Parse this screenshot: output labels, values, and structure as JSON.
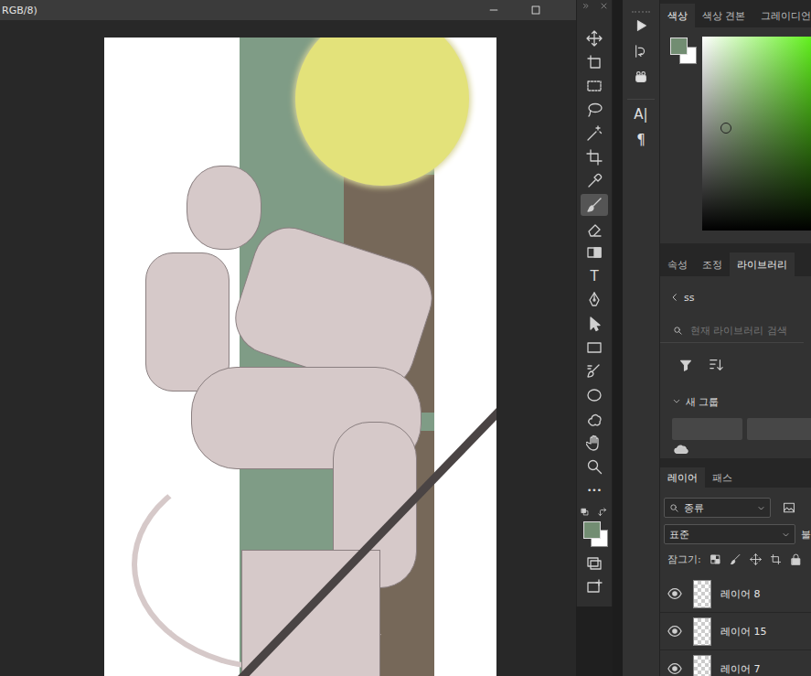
{
  "document": {
    "title": "RGB/8)"
  },
  "toolbar": {
    "tools": [
      {
        "selected": false
      },
      {
        "selected": false
      },
      {
        "selected": false
      },
      {
        "selected": false
      },
      {
        "selected": false
      },
      {
        "selected": false
      },
      {
        "selected": false
      },
      {
        "selected": true
      },
      {
        "selected": false
      },
      {
        "selected": false
      },
      {
        "label": "T",
        "selected": false
      },
      {
        "selected": false
      },
      {
        "selected": false
      },
      {
        "selected": false
      },
      {
        "selected": false
      },
      {
        "selected": false
      },
      {
        "selected": false
      },
      {
        "selected": false
      },
      {
        "selected": false
      },
      {
        "label": "•••",
        "selected": false
      }
    ],
    "foreground": "#728d72",
    "background": "#ffffff"
  },
  "side_panel": {
    "labels": [
      "A|",
      "¶"
    ]
  },
  "color_panel": {
    "tabs": [
      {
        "label": "색상",
        "selected": true
      },
      {
        "label": "색상 견본",
        "selected": false
      },
      {
        "label": "그레이디언",
        "selected": false
      }
    ],
    "foreground": "#728d72",
    "background": "#ffffff",
    "saturation": 0.22,
    "brightness": 0.53
  },
  "library_panel": {
    "tabs": [
      {
        "label": "속성",
        "selected": false
      },
      {
        "label": "조정",
        "selected": false
      },
      {
        "label": "라이브러리",
        "selected": true
      }
    ],
    "library": "ss",
    "search_placeholder": "현재 라이브러리 검색",
    "group": {
      "label": "새 그룹",
      "expanded": true
    }
  },
  "layers_panel": {
    "tabs": [
      {
        "label": "레이어",
        "selected": true
      },
      {
        "label": "패스",
        "selected": false
      }
    ],
    "filter": "종류",
    "blend_mode": "표준",
    "opacity_label": "불",
    "lock_label": "잠그기:",
    "layers": [
      {
        "name": "레이어 8",
        "visible": true
      },
      {
        "name": "레이어 15",
        "visible": true
      },
      {
        "name": "레이어 7",
        "visible": true
      }
    ]
  }
}
